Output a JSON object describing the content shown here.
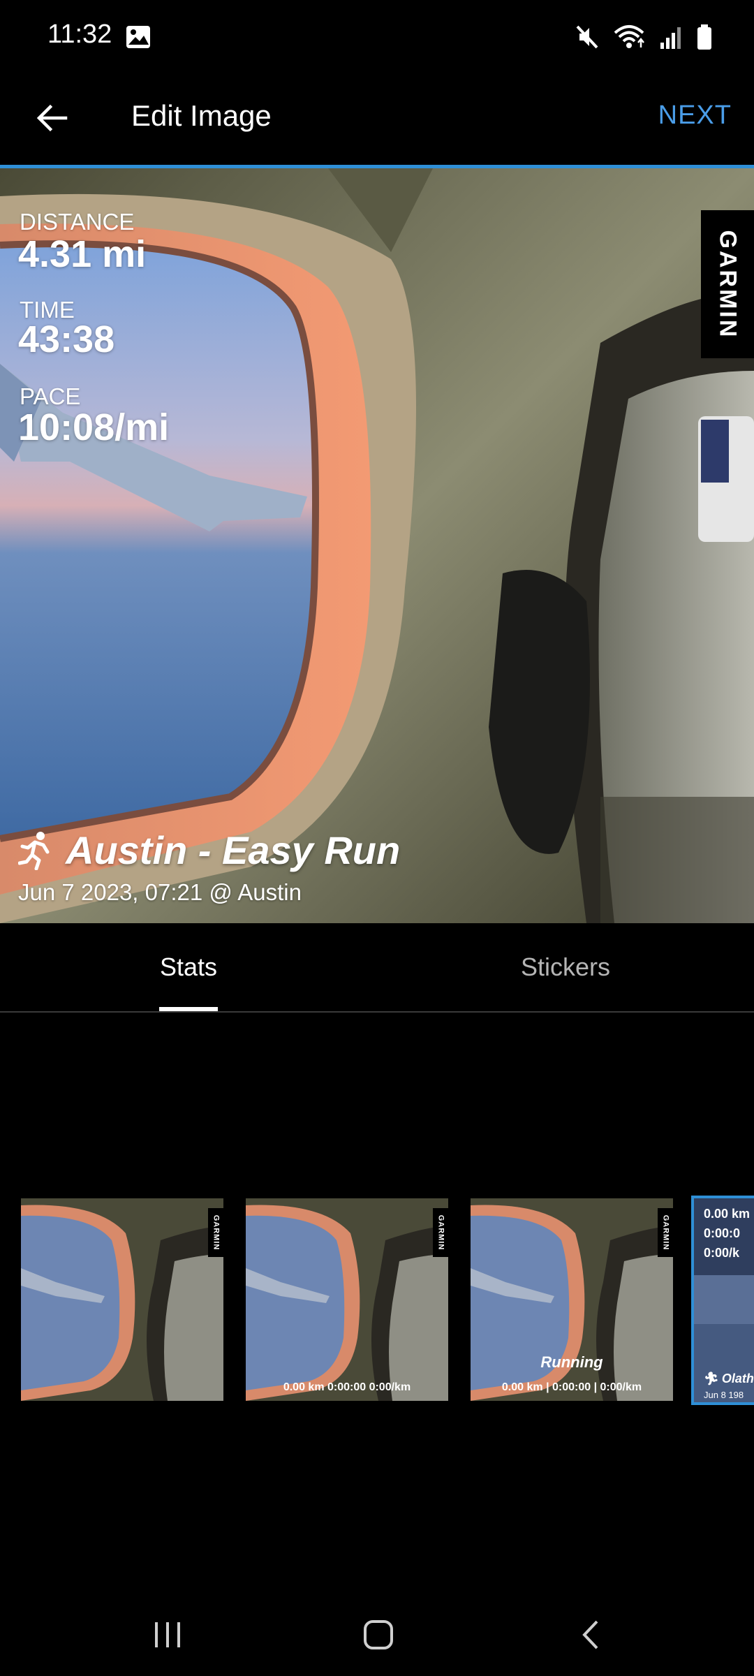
{
  "status_bar": {
    "time": "11:32",
    "icons": [
      "image-notification-icon",
      "mute-icon",
      "wifi-icon",
      "signal-icon",
      "battery-icon"
    ]
  },
  "header": {
    "title": "Edit Image",
    "next_label": "NEXT",
    "accent_color": "#2f8fd6",
    "next_color": "#4a9de8"
  },
  "preview": {
    "stats": [
      {
        "label": "DISTANCE",
        "value": "4.31 mi"
      },
      {
        "label": "TIME",
        "value": "43:38"
      },
      {
        "label": "PACE",
        "value": "10:08/mi"
      }
    ],
    "brand": "GARMIN",
    "activity_title": "Austin - Easy Run",
    "activity_subtitle": "Jun 7 2023, 07:21 @ Austin"
  },
  "tabs": [
    {
      "label": "Stats",
      "selected": true
    },
    {
      "label": "Stickers",
      "selected": false
    }
  ],
  "templates": [
    {
      "stats": ""
    },
    {
      "stats": "0.00 km  0:00:00  0:00/km"
    },
    {
      "title": "Running",
      "stats": "0.00 km | 0:00:00 | 0:00/km"
    },
    {
      "lines": [
        "0.00 km",
        "0:00:0",
        "0:00/k"
      ],
      "title": "Olath",
      "date": "Jun 8 198",
      "selected": true
    }
  ],
  "nav_bar": {
    "buttons": [
      "recents-icon",
      "home-icon",
      "back-icon"
    ]
  }
}
